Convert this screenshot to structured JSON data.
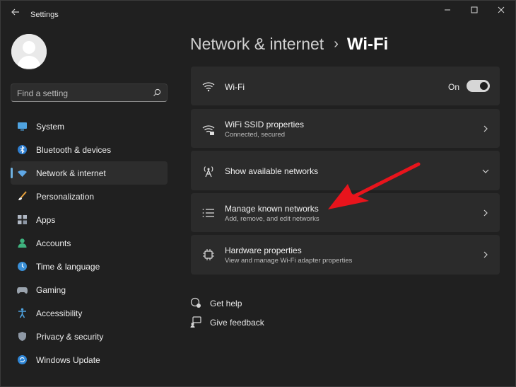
{
  "window": {
    "title": "Settings",
    "controls": [
      "minimize-icon",
      "maximize-icon",
      "close-icon"
    ]
  },
  "search": {
    "placeholder": "Find a setting"
  },
  "sidebar": {
    "selected_index": 2,
    "items": [
      {
        "label": "System",
        "icon": "system-icon"
      },
      {
        "label": "Bluetooth & devices",
        "icon": "bluetooth-icon"
      },
      {
        "label": "Network & internet",
        "icon": "network-icon"
      },
      {
        "label": "Personalization",
        "icon": "brush-icon"
      },
      {
        "label": "Apps",
        "icon": "apps-icon"
      },
      {
        "label": "Accounts",
        "icon": "accounts-icon"
      },
      {
        "label": "Time & language",
        "icon": "globe-clock-icon"
      },
      {
        "label": "Gaming",
        "icon": "gamepad-icon"
      },
      {
        "label": "Accessibility",
        "icon": "accessibility-icon"
      },
      {
        "label": "Privacy & security",
        "icon": "shield-icon"
      },
      {
        "label": "Windows Update",
        "icon": "update-icon"
      }
    ]
  },
  "breadcrumb": {
    "parent": "Network & internet",
    "separator": "›",
    "current": "Wi-Fi"
  },
  "cards": {
    "wifi": {
      "title": "Wi-Fi",
      "state": "On"
    },
    "properties": {
      "title": "WiFi SSID properties",
      "subtitle": "Connected, secured"
    },
    "available": {
      "title": "Show available networks"
    },
    "known": {
      "title": "Manage known networks",
      "subtitle": "Add, remove, and edit networks"
    },
    "hardware": {
      "title": "Hardware properties",
      "subtitle": "View and manage Wi-Fi adapter properties"
    }
  },
  "help": {
    "get_help": "Get help",
    "give_feedback": "Give feedback"
  },
  "colors": {
    "background": "#202020",
    "card": "#2b2b2b",
    "accent": "#6fb1e0",
    "annotation_arrow": "#e8141c"
  }
}
